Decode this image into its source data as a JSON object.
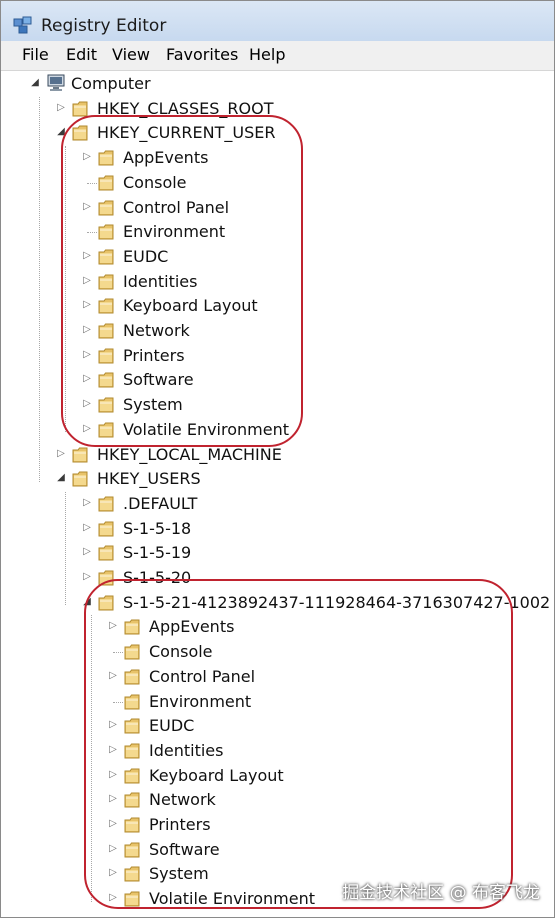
{
  "window": {
    "title": "Registry Editor",
    "icon": "registry-editor-icon"
  },
  "menu": [
    "File",
    "Edit",
    "View",
    "Favorites",
    "Help"
  ],
  "tree": [
    {
      "label": "Computer",
      "level": 0,
      "expander": "expanded",
      "icon": "computer-icon"
    },
    {
      "label": "HKEY_CLASSES_ROOT",
      "level": 1,
      "expander": "collapsed",
      "icon": "folder-icon"
    },
    {
      "label": "HKEY_CURRENT_USER",
      "level": 1,
      "expander": "expanded",
      "icon": "folder-icon"
    },
    {
      "label": "AppEvents",
      "level": 2,
      "expander": "collapsed",
      "icon": "folder-icon"
    },
    {
      "label": "Console",
      "level": 2,
      "expander": "none",
      "icon": "folder-icon"
    },
    {
      "label": "Control Panel",
      "level": 2,
      "expander": "collapsed",
      "icon": "folder-icon"
    },
    {
      "label": "Environment",
      "level": 2,
      "expander": "none",
      "icon": "folder-icon"
    },
    {
      "label": "EUDC",
      "level": 2,
      "expander": "collapsed",
      "icon": "folder-icon"
    },
    {
      "label": "Identities",
      "level": 2,
      "expander": "collapsed",
      "icon": "folder-icon"
    },
    {
      "label": "Keyboard Layout",
      "level": 2,
      "expander": "collapsed",
      "icon": "folder-icon"
    },
    {
      "label": "Network",
      "level": 2,
      "expander": "collapsed",
      "icon": "folder-icon"
    },
    {
      "label": "Printers",
      "level": 2,
      "expander": "collapsed",
      "icon": "folder-icon"
    },
    {
      "label": "Software",
      "level": 2,
      "expander": "collapsed",
      "icon": "folder-icon"
    },
    {
      "label": "System",
      "level": 2,
      "expander": "collapsed",
      "icon": "folder-icon"
    },
    {
      "label": "Volatile Environment",
      "level": 2,
      "expander": "collapsed",
      "icon": "folder-icon"
    },
    {
      "label": "HKEY_LOCAL_MACHINE",
      "level": 1,
      "expander": "collapsed",
      "icon": "folder-icon"
    },
    {
      "label": "HKEY_USERS",
      "level": 1,
      "expander": "expanded",
      "icon": "folder-icon"
    },
    {
      "label": ".DEFAULT",
      "level": 2,
      "expander": "collapsed",
      "icon": "folder-icon"
    },
    {
      "label": "S-1-5-18",
      "level": 2,
      "expander": "collapsed",
      "icon": "folder-icon"
    },
    {
      "label": "S-1-5-19",
      "level": 2,
      "expander": "collapsed",
      "icon": "folder-icon"
    },
    {
      "label": "S-1-5-20",
      "level": 2,
      "expander": "collapsed",
      "icon": "folder-icon"
    },
    {
      "label": "S-1-5-21-4123892437-111928464-3716307427-1002",
      "level": 2,
      "expander": "expanded",
      "icon": "folder-icon"
    },
    {
      "label": "AppEvents",
      "level": 3,
      "expander": "collapsed",
      "icon": "folder-icon"
    },
    {
      "label": "Console",
      "level": 3,
      "expander": "none",
      "icon": "folder-icon"
    },
    {
      "label": "Control Panel",
      "level": 3,
      "expander": "collapsed",
      "icon": "folder-icon"
    },
    {
      "label": "Environment",
      "level": 3,
      "expander": "none",
      "icon": "folder-icon"
    },
    {
      "label": "EUDC",
      "level": 3,
      "expander": "collapsed",
      "icon": "folder-icon"
    },
    {
      "label": "Identities",
      "level": 3,
      "expander": "collapsed",
      "icon": "folder-icon"
    },
    {
      "label": "Keyboard Layout",
      "level": 3,
      "expander": "collapsed",
      "icon": "folder-icon"
    },
    {
      "label": "Network",
      "level": 3,
      "expander": "collapsed",
      "icon": "folder-icon"
    },
    {
      "label": "Printers",
      "level": 3,
      "expander": "collapsed",
      "icon": "folder-icon"
    },
    {
      "label": "Software",
      "level": 3,
      "expander": "collapsed",
      "icon": "folder-icon"
    },
    {
      "label": "System",
      "level": 3,
      "expander": "collapsed",
      "icon": "folder-icon"
    },
    {
      "label": "Volatile Environment",
      "level": 3,
      "expander": "collapsed",
      "icon": "folder-icon"
    }
  ],
  "annotations": {
    "highlight_color": "#c0232f"
  },
  "watermark": "掘金技术社区 @ 布客飞龙"
}
